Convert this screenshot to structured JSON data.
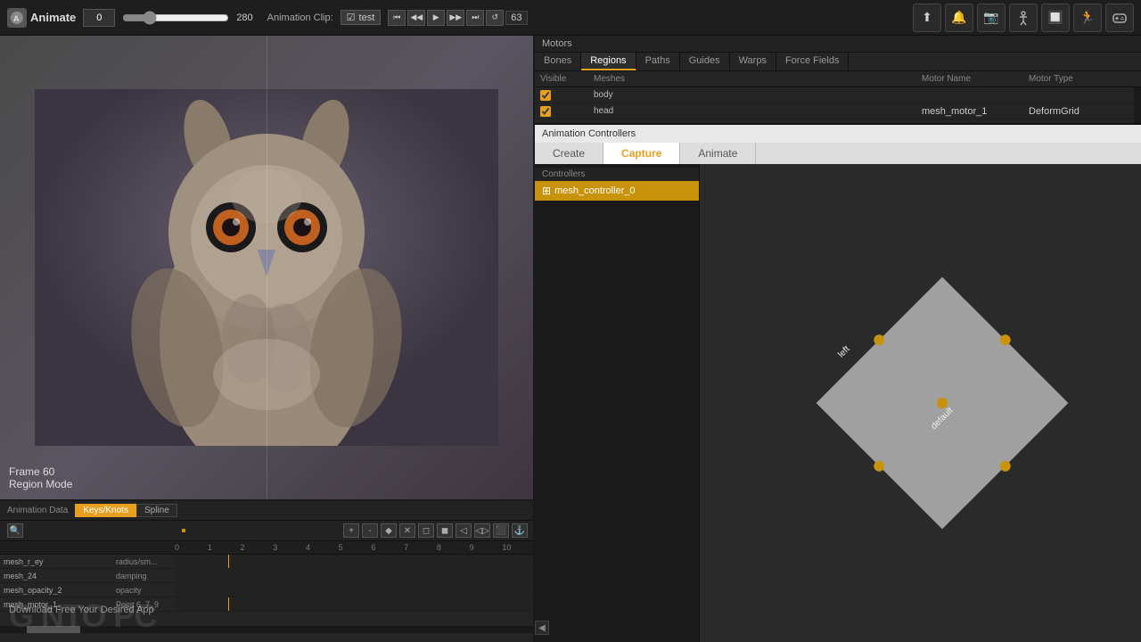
{
  "app": {
    "title": "Animate",
    "logo_char": "🐾"
  },
  "topbar": {
    "frame_start": "0",
    "frame_end": "280",
    "frame_current": "63",
    "animation_clip_label": "Animation Clip:",
    "clip_name": "test",
    "transport": {
      "rewind": "⏮",
      "step_back": "◀◀",
      "play": "▶",
      "step_forward": "▶▶",
      "forward": "⏭",
      "loop": "↺"
    },
    "icons": [
      "⬆",
      "🔔",
      "📷",
      "👥",
      "🔲",
      "🏃",
      "🎮"
    ]
  },
  "motors": {
    "header": "Motors",
    "tabs": [
      "Bones",
      "Regions",
      "Paths",
      "Guides",
      "Warps",
      "Force Fields"
    ],
    "active_tab": "Regions",
    "columns": {
      "visible": "Visible",
      "meshes": "Meshes",
      "motor_name": "Motor Name",
      "motor_type": "Motor Type"
    },
    "rows": [
      {
        "visible": true,
        "meshes": [
          "body"
        ],
        "motor_name": "",
        "motor_type": ""
      },
      {
        "visible": true,
        "meshes": [
          "head"
        ],
        "motor_name": "mesh_motor_1",
        "motor_type": "DeformGrid"
      }
    ]
  },
  "animation_controllers": {
    "header": "Animation Controllers",
    "tabs": [
      "Create",
      "Capture",
      "Animate"
    ],
    "active_tab": "Capture",
    "controllers_header": "Controllers",
    "controller_item": "mesh_controller_0",
    "control_points": {
      "top": "",
      "bottom": "",
      "left": "left",
      "right": "",
      "center": "default"
    }
  },
  "viewport": {
    "frame_label": "Frame 60",
    "mode_label": "Region Mode"
  },
  "animation_data": {
    "header": "Animation Data",
    "tabs": [
      "Keys/Knots",
      "Spline"
    ],
    "active_tab": "Keys/Knots",
    "rows": [
      {
        "label": "mesh_r_ey",
        "sublabel": "radius/smoothness"
      },
      {
        "label": "mesh_24",
        "sublabel": "damping"
      },
      {
        "label": "mesh_opacity_2",
        "sublabel": "opacity"
      },
      {
        "label": "mesh_motor_1",
        "sublabel": "Point 6, 7, 9"
      }
    ],
    "timeline_numbers": [
      "0",
      "1",
      "2",
      "3",
      "4",
      "5",
      "6",
      "7",
      "8",
      "9",
      "10"
    ]
  },
  "watermark": {
    "text": "GINTO PC",
    "sub": "Download Free Your Desired App"
  }
}
